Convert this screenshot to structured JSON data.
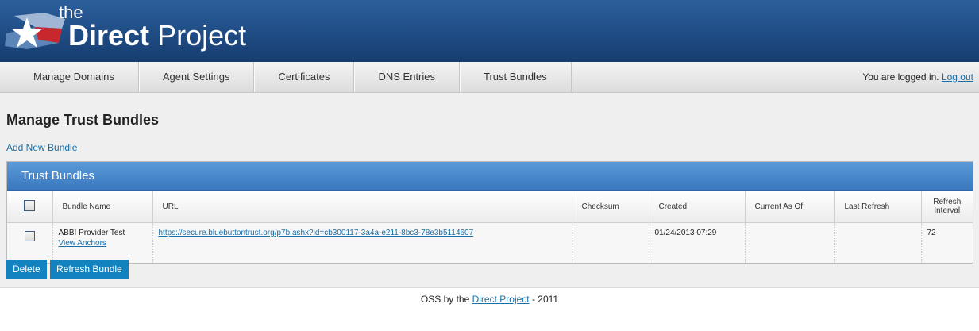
{
  "logo": {
    "the": "the",
    "word1": "Direct",
    "word2": "Project"
  },
  "nav": {
    "items": [
      "Manage Domains",
      "Agent Settings",
      "Certificates",
      "DNS Entries",
      "Trust Bundles"
    ],
    "status_text": "You are logged in. ",
    "logout": "Log out"
  },
  "page": {
    "title": "Manage Trust Bundles",
    "add_link": "Add New Bundle"
  },
  "panel": {
    "title": "Trust Bundles",
    "columns": [
      "Bundle Name",
      "URL",
      "Checksum",
      "Created",
      "Current As Of",
      "Last Refresh",
      "Refresh Interval"
    ],
    "rows": [
      {
        "bundle_name": "ABBI Provider Test",
        "view_anchors": "View Anchors",
        "url": "https://secure.bluebuttontrust.org/p7b.ashx?id=cb300117-3a4a-e211-8bc3-78e3b5114607",
        "checksum": "",
        "created": "01/24/2013 07:29",
        "current_as_of": "",
        "last_refresh": "",
        "refresh_interval": "72"
      }
    ]
  },
  "buttons": {
    "delete": "Delete",
    "refresh": "Refresh Bundle"
  },
  "footer": {
    "prefix": "OSS by the ",
    "link": "Direct Project",
    "suffix": " - 2011"
  },
  "colors": {
    "header_blue": "#1e4a82",
    "panel_blue": "#3a78bf",
    "button_blue": "#1383c0",
    "link": "#1a6fa8"
  }
}
